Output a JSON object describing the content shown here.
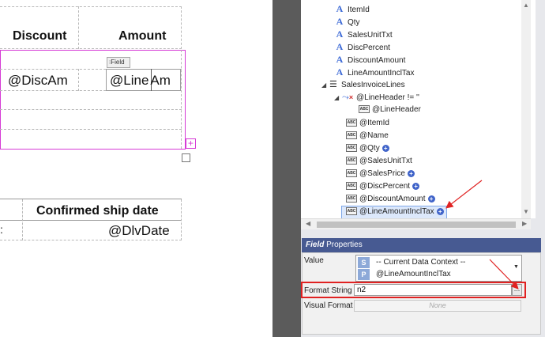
{
  "canvas": {
    "col_discount": "Discount",
    "col_amount": "Amount",
    "field_tag": "Field",
    "cell_discount": "@DiscAm",
    "cell_amount_a": "@Line",
    "cell_amount_b": "Am",
    "col_ship_date": "Confirmed ship date",
    "cell_ship_date": "@DlvDate",
    "cell_stub": ":"
  },
  "tree": {
    "items": [
      {
        "icon": "A",
        "label": "ItemId"
      },
      {
        "icon": "A",
        "label": "Qty"
      },
      {
        "icon": "A",
        "label": "SalesUnitTxt"
      },
      {
        "icon": "A",
        "label": "DiscPercent"
      },
      {
        "icon": "A",
        "label": "DiscountAmount"
      },
      {
        "icon": "A",
        "label": "LineAmountInclTax"
      },
      {
        "icon": "list",
        "label": "SalesInvoiceLines"
      },
      {
        "icon": "cond",
        "label": "@LineHeader != ''"
      },
      {
        "icon": "abc",
        "label": "@LineHeader"
      },
      {
        "icon": "abc",
        "label": "@ItemId"
      },
      {
        "icon": "abc",
        "label": "@Name"
      },
      {
        "icon": "abc",
        "label": "@Qty"
      },
      {
        "icon": "abc",
        "label": "@SalesUnitTxt"
      },
      {
        "icon": "abc",
        "label": "@SalesPrice"
      },
      {
        "icon": "abc",
        "label": "@DiscPercent"
      },
      {
        "icon": "abc",
        "label": "@DiscountAmount"
      },
      {
        "icon": "abc",
        "label": "@LineAmountInclTax"
      }
    ],
    "abc_glyph": "ABC",
    "plus_glyph": "+"
  },
  "properties": {
    "title_italic": "Field",
    "title_rest": "Properties",
    "value_label": "Value",
    "value_context": "-- Current Data Context --",
    "value_path": "@LineAmountInclTax",
    "badge_s": "S",
    "badge_p": "P",
    "format_label": "Format String",
    "format_value": "n2",
    "ellipsis": "...",
    "visual_label": "Visual Format",
    "visual_value": "None"
  },
  "colors": {
    "selection_magenta": "#d63bd6",
    "highlight_red": "#e02222",
    "panel_title_blue": "#475a92",
    "tree_selected": "#dce8fb"
  }
}
